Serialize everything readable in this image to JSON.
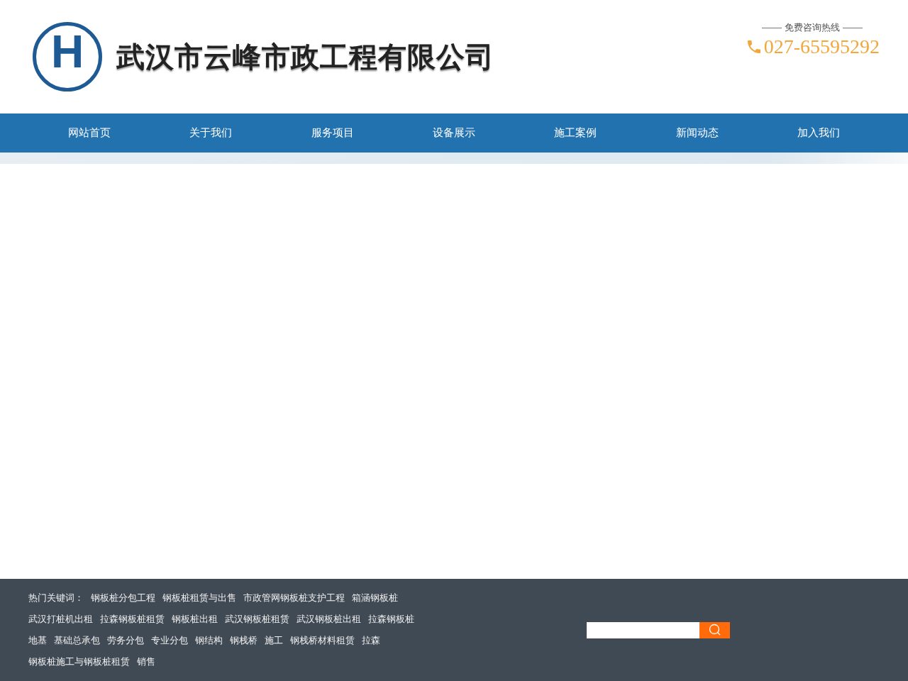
{
  "header": {
    "logo_letter": "H",
    "company_name": "武汉市云峰市政工程有限公司",
    "hotline_label": "免费咨询热线",
    "phone": "027-65595292"
  },
  "nav": [
    {
      "label": "网站首页"
    },
    {
      "label": "关于我们"
    },
    {
      "label": "服务项目"
    },
    {
      "label": "设备展示"
    },
    {
      "label": "施工案例"
    },
    {
      "label": "新闻动态"
    },
    {
      "label": "加入我们"
    }
  ],
  "footer": {
    "keywords_label": "热门关键词：",
    "keyword_rows": [
      [
        "钢板桩分包工程",
        "钢板桩租赁与出售",
        "市政管网钢板桩支护工程",
        "箱涵钢板桩"
      ],
      [
        "武汉打桩机出租",
        "拉森钢板桩租赁",
        "钢板桩出租",
        "武汉钢板桩租赁",
        "武汉钢板桩出租",
        "拉森钢板桩"
      ],
      [
        "地基",
        "基础总承包",
        "劳务分包",
        "专业分包",
        "钢结构",
        "钢栈桥",
        "施工",
        "钢栈桥材料租赁",
        "拉森"
      ],
      [
        "钢板桩施工与钢板桩租赁",
        "销售"
      ]
    ]
  }
}
